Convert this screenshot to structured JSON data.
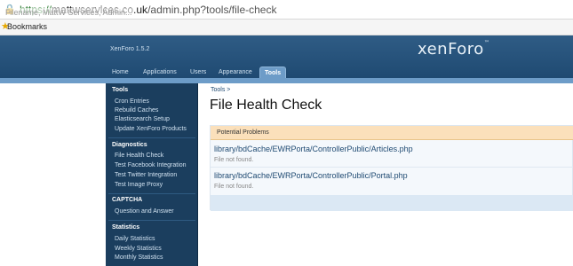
{
  "browser": {
    "url_proto": "https://",
    "url_host": "mattwservices.co.uk",
    "url_path": "/admin.php?tools/file-check",
    "tooltip": "Filename, MattW Services, Admin..."
  },
  "bookmarks": {
    "label": "Bookmarks"
  },
  "header": {
    "version": "XenForo 1.5.2",
    "logo": "xenForo"
  },
  "tabs": [
    {
      "label": "Home"
    },
    {
      "label": "Applications"
    },
    {
      "label": "Users"
    },
    {
      "label": "Appearance"
    },
    {
      "label": "Tools"
    }
  ],
  "sidebar": {
    "sections": [
      {
        "title": "Tools",
        "items": [
          "Cron Entries",
          "Rebuild Caches",
          "Elasticsearch Setup",
          "Update XenForo Products"
        ]
      },
      {
        "title": "Diagnostics",
        "items": [
          "File Health Check",
          "Test Facebook Integration",
          "Test Twitter Integration",
          "Test Image Proxy"
        ]
      },
      {
        "title": "CAPTCHA",
        "items": [
          "Question and Answer"
        ]
      },
      {
        "title": "Statistics",
        "items": [
          "Daily Statistics",
          "Weekly Statistics",
          "Monthly Statistics"
        ]
      }
    ]
  },
  "main": {
    "breadcrumb": "Tools >",
    "title": "File Health Check",
    "problems_header": "Potential Problems",
    "problems": [
      {
        "path": "library/bdCache/EWRPorta/ControllerPublic/Articles.php",
        "status": "File not found."
      },
      {
        "path": "library/bdCache/EWRPorta/ControllerPublic/Portal.php",
        "status": "File not found."
      }
    ]
  }
}
